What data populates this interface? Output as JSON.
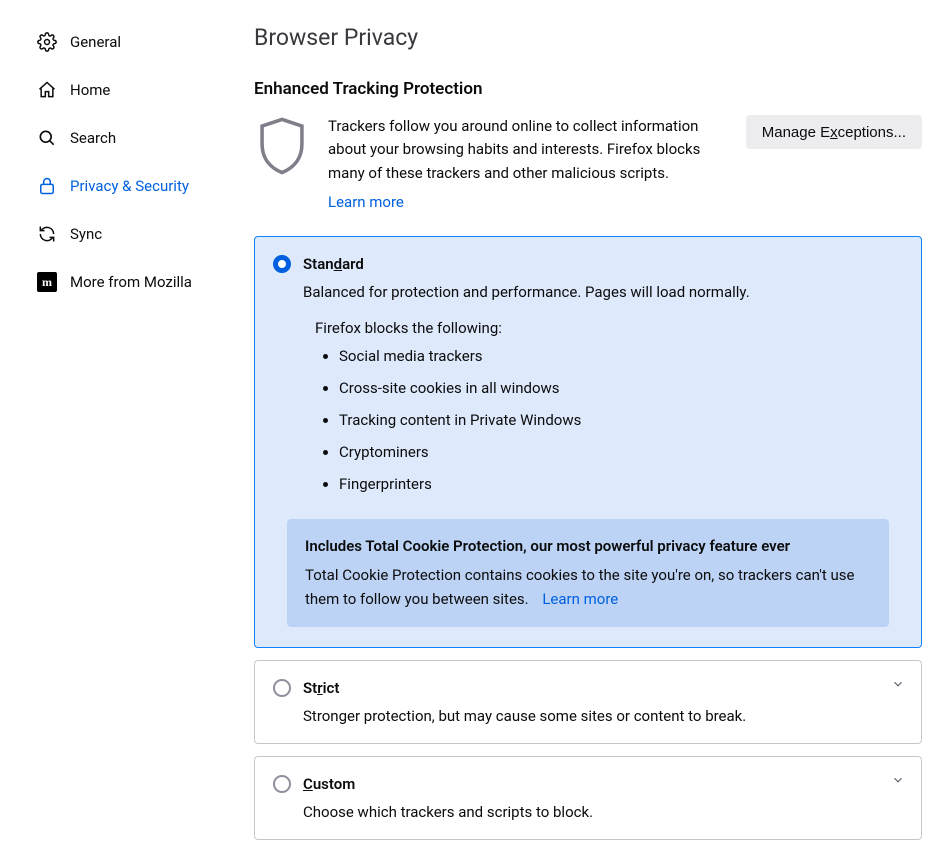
{
  "sidebar": {
    "items": [
      {
        "label": "General"
      },
      {
        "label": "Home"
      },
      {
        "label": "Search"
      },
      {
        "label": "Privacy & Security"
      },
      {
        "label": "Sync"
      },
      {
        "label": "More from Mozilla"
      }
    ]
  },
  "page": {
    "title": "Browser Privacy",
    "section_title": "Enhanced Tracking Protection",
    "intro_text": "Trackers follow you around online to collect information about your browsing habits and interests. Firefox blocks many of these trackers and other malicious scripts.",
    "learn_more": "Learn more",
    "manage_exceptions_pre": "Manage E",
    "manage_exceptions_mid": "x",
    "manage_exceptions_post": "ceptions..."
  },
  "options": {
    "standard": {
      "title_pre": "Stan",
      "title_u": "d",
      "title_post": "ard",
      "desc": "Balanced for protection and performance. Pages will load normally.",
      "blocks_heading": "Firefox blocks the following:",
      "list": [
        "Social media trackers",
        "Cross-site cookies in all windows",
        "Tracking content in Private Windows",
        "Cryptominers",
        "Fingerprinters"
      ],
      "callout_title": "Includes Total Cookie Protection, our most powerful privacy feature ever",
      "callout_text": "Total Cookie Protection contains cookies to the site you're on, so trackers can't use them to follow you between sites.",
      "callout_link": "Learn more"
    },
    "strict": {
      "title_pre": "St",
      "title_u": "r",
      "title_post": "ict",
      "desc": "Stronger protection, but may cause some sites or content to break."
    },
    "custom": {
      "title_pre": "",
      "title_u": "C",
      "title_post": "ustom",
      "desc": "Choose which trackers and scripts to block."
    }
  }
}
